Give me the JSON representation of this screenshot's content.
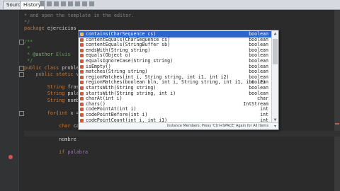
{
  "tabs": [
    {
      "label": "Source"
    },
    {
      "label": "History"
    }
  ],
  "top_text": "* and open the template in the editor.",
  "code": [
    {
      "segs": [
        {
          "t": "* and open the template in the editor.",
          "c": "c-comment"
        }
      ]
    },
    {
      "segs": [
        {
          "t": "*/",
          "c": "c-comment"
        }
      ]
    },
    {
      "segs": [
        {
          "t": "package ",
          "c": "c-kw"
        },
        {
          "t": "ejercicios",
          "c": "c-type"
        }
      ]
    },
    {
      "segs": [
        {
          "t": "",
          "c": "c-type"
        }
      ]
    },
    {
      "segs": [
        {
          "t": "/**",
          "c": "c-doc"
        }
      ]
    },
    {
      "segs": [
        {
          "t": " *",
          "c": "c-doc"
        }
      ]
    },
    {
      "segs": [
        {
          "t": " * ",
          "c": "c-doc"
        },
        {
          "t": "@author",
          "c": "c-tag"
        },
        {
          "t": " Elvis",
          "c": "c-doc"
        }
      ]
    },
    {
      "segs": [
        {
          "t": " */",
          "c": "c-doc"
        }
      ]
    },
    {
      "segs": [
        {
          "t": "public class ",
          "c": "c-kw"
        },
        {
          "t": "proble",
          "c": "c-type"
        }
      ]
    },
    {
      "segs": [
        {
          "t": "    public static ",
          "c": "c-kw"
        },
        {
          "t": "v",
          "c": "c-type"
        }
      ]
    },
    {
      "segs": [
        {
          "t": "",
          "c": "c-type"
        }
      ]
    },
    {
      "segs": [
        {
          "t": "        String ",
          "c": "c-kw"
        },
        {
          "t": "frase",
          "c": "c-type"
        }
      ]
    },
    {
      "segs": [
        {
          "t": "        String ",
          "c": "c-kw"
        },
        {
          "t": "palab",
          "c": "c-type"
        }
      ]
    },
    {
      "segs": [
        {
          "t": "        String ",
          "c": "c-kw"
        },
        {
          "t": "nombr",
          "c": "c-type"
        }
      ]
    },
    {
      "segs": [
        {
          "t": "",
          "c": "c-type"
        }
      ]
    },
    {
      "segs": [
        {
          "t": "        for",
          "c": "c-kw"
        },
        {
          "t": "(",
          "c": "c-type"
        },
        {
          "t": "int ",
          "c": "c-kw"
        },
        {
          "t": "x =",
          "c": "c-type"
        }
      ]
    },
    {
      "segs": [
        {
          "t": "",
          "c": "c-type"
        }
      ]
    },
    {
      "segs": [
        {
          "t": "            char ",
          "c": "c-kw"
        },
        {
          "t": "car",
          "c": "c-type"
        }
      ]
    },
    {
      "segs": [
        {
          "t": "",
          "c": "c-type"
        }
      ]
    },
    {
      "segs": [
        {
          "t": "            nombre",
          "c": "c-type"
        }
      ]
    },
    {
      "segs": [
        {
          "t": "",
          "c": "c-type"
        }
      ]
    },
    {
      "segs": [
        {
          "t": "            if ",
          "c": "c-kw"
        },
        {
          "t": "palabra",
          "c": "c-ident"
        }
      ]
    }
  ],
  "completion": {
    "items": [
      {
        "sig": "contains(CharSequence cs)",
        "ret": "boolean"
      },
      {
        "sig": "contentEquals(CharSequence cs)",
        "ret": "boolean"
      },
      {
        "sig": "contentEquals(StringBuffer sb)",
        "ret": "boolean"
      },
      {
        "sig": "endsWith(String string)",
        "ret": "boolean"
      },
      {
        "sig": "equals(Object o)",
        "ret": "boolean"
      },
      {
        "sig": "equalsIgnoreCase(String string)",
        "ret": "boolean"
      },
      {
        "sig": "isEmpty()",
        "ret": "boolean"
      },
      {
        "sig": "matches(String string)",
        "ret": "boolean"
      },
      {
        "sig": "regionMatches(int i, String string, int i1, int i2)",
        "ret": "boolean"
      },
      {
        "sig": "regionMatches(boolean bln, int i, String string, int i1, int i2)",
        "ret": "boolean"
      },
      {
        "sig": "startsWith(String string)",
        "ret": "boolean"
      },
      {
        "sig": "startsWith(String string, int i)",
        "ret": "boolean"
      },
      {
        "sig": "charAt(int i)",
        "ret": "char"
      },
      {
        "sig": "chars()",
        "ret": "IntStream"
      },
      {
        "sig": "codePointAt(int i)",
        "ret": "int"
      },
      {
        "sig": "codePointBefore(int i)",
        "ret": "int"
      },
      {
        "sig": "codePointCount(int i, int i1)",
        "ret": "int"
      }
    ],
    "footer_hint": "Instance Members; Press 'Ctrl+SPACE' Again for All Items"
  },
  "colors": {
    "selection": "#2f65ca",
    "editor_bg": "#2b2b2b",
    "error": "#d9534f"
  }
}
